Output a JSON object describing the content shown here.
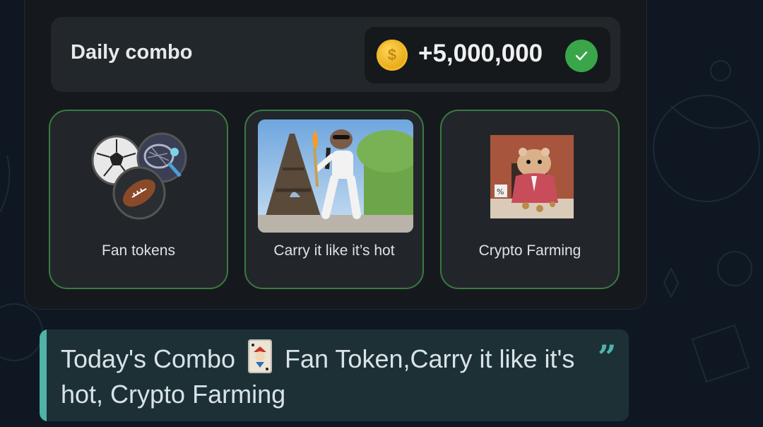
{
  "daily_combo": {
    "title": "Daily combo",
    "reward_amount": "+5,000,000",
    "coin_symbol": "$",
    "completed": true
  },
  "cards": [
    {
      "label": "Fan tokens",
      "image": "sports-balls-icon"
    },
    {
      "label": "Carry it like it’s hot",
      "image": "hamster-torch-eiffel-tower-photo"
    },
    {
      "label": "Crypto Farming",
      "image": "hamster-businessman-photo"
    }
  ],
  "message": {
    "text_before_icon": "Today's Combo",
    "icon": "joker-card-icon",
    "text_after_icon": "Fan Token,Carry it like it's hot, Crypto Farming",
    "quote_icon": "quote-icon"
  },
  "colors": {
    "panel": "#15191d",
    "card_border": "#3b7a3e",
    "check": "#3aa64a",
    "coin": "#e8a814",
    "message_bg": "#1d3036",
    "message_accent": "#4fb3a8"
  }
}
